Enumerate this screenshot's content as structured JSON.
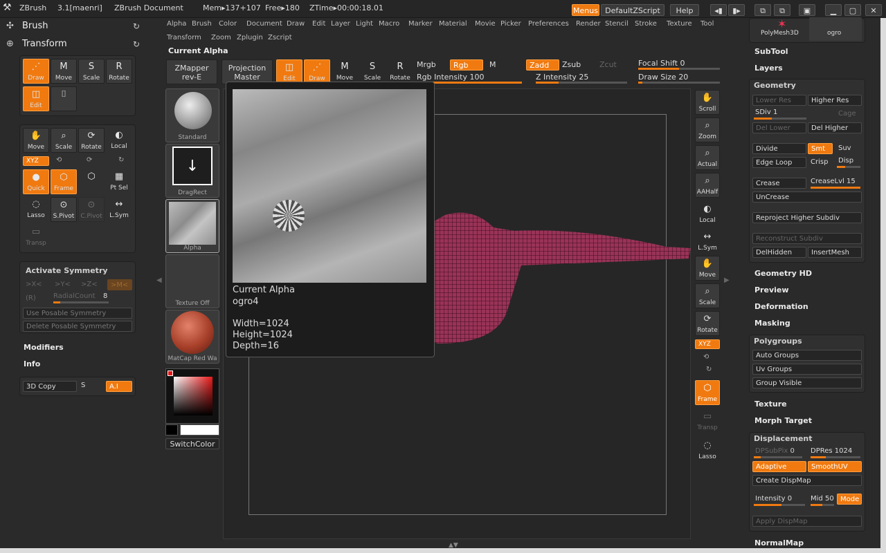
{
  "titlebar": {
    "app": "ZBrush",
    "version": "3.1[maenri]",
    "doc": "ZBrush Document",
    "mem": "Mem▸137+107",
    "free": "Free▸180",
    "ztime": "ZTime▸00:00:18.01",
    "menus_btn": "Menus",
    "script_btn": "DefaultZScript",
    "help_btn": "Help"
  },
  "menubar": {
    "row1": [
      "Alpha",
      "Brush",
      "Color",
      "Document",
      "Draw",
      "Edit",
      "Layer",
      "Light",
      "Macro",
      "Marker",
      "Material",
      "Movie",
      "Picker",
      "Preferences",
      "Render",
      "Stencil",
      "Stroke",
      "Texture",
      "Tool"
    ],
    "row2": [
      "Transform",
      "Zoom",
      "Zplugin",
      "Zscript"
    ]
  },
  "current_alpha_label": "Current Alpha",
  "left_headers": {
    "brush": "Brush",
    "transform": "Transform"
  },
  "tools1": {
    "draw": "Draw",
    "move": "Move",
    "scale": "Scale",
    "rotate": "Rotate",
    "edit": "Edit"
  },
  "tools2": {
    "move": "Move",
    "scale": "Scale",
    "rotate": "Rotate",
    "local": "Local",
    "xyz": "XYZ",
    "quick": "Quick",
    "frame": "Frame",
    "ptsel": "Pt Sel",
    "lasso": "Lasso",
    "spivot": "S.Pivot",
    "cpivot": "C.Pivot",
    "lsym": "L.Sym",
    "transp": "Transp"
  },
  "symmetry": {
    "title": "Activate Symmetry",
    "x": ">X<",
    "y": ">Y<",
    "z": ">Z<",
    "m": ">M<",
    "r": "(R)",
    "radial_label": "RadialCount",
    "radial_value": "8",
    "use_posable": "Use Posable Symmetry",
    "delete_posable": "Delete Posable Symmetry"
  },
  "left_sections": {
    "modifiers": "Modifiers",
    "info": "Info"
  },
  "copy_panel": {
    "copy": "3D Copy",
    "s": "S",
    "ai": "A.I"
  },
  "shelf": {
    "zmapper_1": "ZMapper",
    "zmapper_2": "rev-E",
    "projection_1": "Projection",
    "projection_2": "Master",
    "edit": "Edit",
    "draw": "Draw",
    "move": "Move",
    "scale": "Scale",
    "rotate": "Rotate",
    "mrgb": "Mrgb",
    "rgb": "Rgb",
    "m": "M",
    "zadd": "Zadd",
    "zsub": "Zsub",
    "zcut": "Zcut",
    "focal_label": "Focal Shift",
    "focal_value": "0",
    "rgb_int_label": "Rgb Intensity",
    "rgb_int_value": "100",
    "z_int_label": "Z Intensity",
    "z_int_value": "25",
    "draw_size_label": "Draw Size",
    "draw_size_value": "20",
    "rgb_intensity": 1.0,
    "z_intensity": 0.25,
    "focal_shift": 0.5,
    "draw_size": 0.05
  },
  "thumbs": {
    "brush": "Standard",
    "stroke": "DragRect",
    "alpha": "Alpha",
    "texture": "Texture Off",
    "material": "MatCap Red Wa"
  },
  "switch_color": "SwitchColor",
  "popup": {
    "title": "Current Alpha",
    "name": "ogro4",
    "width": "Width=1024",
    "height": "Height=1024",
    "depth": "Depth=16"
  },
  "right_tools": {
    "scroll": "Scroll",
    "zoom": "Zoom",
    "actual": "Actual",
    "aahalf": "AAHalf",
    "local": "Local",
    "lsym": "L.Sym",
    "move": "Move",
    "scale": "Scale",
    "rotate": "Rotate",
    "xyz": "XYZ",
    "frame": "Frame",
    "transp": "Transp",
    "lasso": "Lasso"
  },
  "tool_panel": {
    "polymesh": "PolyMesh3D",
    "ogro": "ogro",
    "subtool": "SubTool",
    "layers": "Layers",
    "geometry": "Geometry",
    "lower_res": "Lower Res",
    "higher_res": "Higher Res",
    "sdiv_label": "SDiv",
    "sdiv_value": "1",
    "cage": "Cage",
    "del_lower": "Del Lower",
    "del_higher": "Del Higher",
    "divide": "Divide",
    "smt": "Smt",
    "suv": "Suv",
    "edge_loop": "Edge Loop",
    "crisp": "Crisp",
    "disp": "Disp",
    "crease": "Crease",
    "crease_lvl_label": "CreaseLvl",
    "crease_lvl_value": "15",
    "uncrease": "UnCrease",
    "reproject": "Reproject Higher Subdiv",
    "reconstruct": "Reconstruct Subdiv",
    "delhidden": "DelHidden",
    "insertmesh": "InsertMesh",
    "geometry_hd": "Geometry HD",
    "preview": "Preview",
    "deformation": "Deformation",
    "masking": "Masking",
    "polygroups": "Polygroups",
    "auto_groups": "Auto Groups",
    "uv_groups": "Uv Groups",
    "group_visible": "Group Visible",
    "texture": "Texture",
    "morph_target": "Morph Target",
    "displacement": "Displacement",
    "dpsubpix_label": "DPSubPix",
    "dpsubpix_value": "0",
    "dpres_label": "DPRes",
    "dpres_value": "1024",
    "adaptive": "Adaptive",
    "smoothuv": "SmoothUV",
    "create_dispmap": "Create DispMap",
    "intensity_label": "Intensity",
    "intensity_value": "0",
    "mid_label": "Mid",
    "mid_value": "50",
    "mode": "Mode",
    "apply_dispmap": "Apply DispMap",
    "normalmap": "NormalMap"
  },
  "colors": {
    "accent": "#f07a10",
    "bg": "#2a2a2a",
    "canvas": "#262626"
  }
}
